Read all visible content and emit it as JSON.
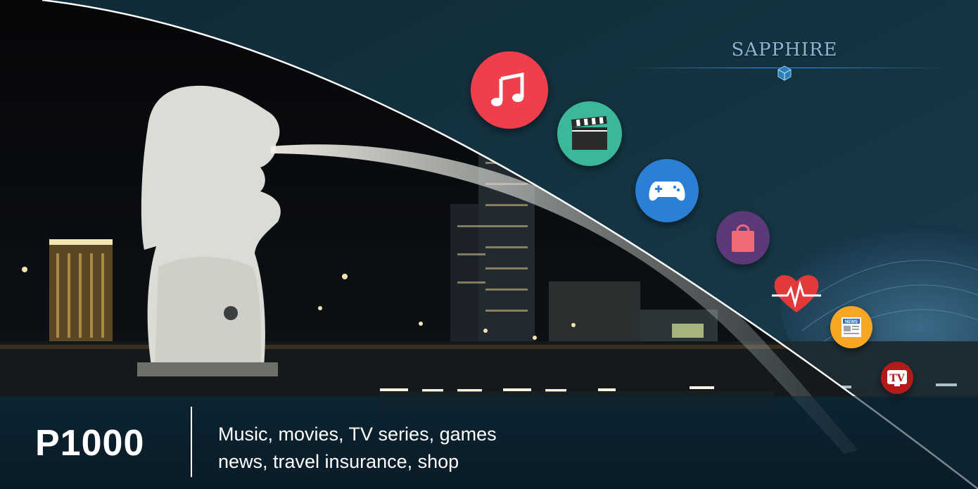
{
  "brand": {
    "name": "SAPPHIRE"
  },
  "offer": {
    "price": "P1000",
    "line1": "Music, movies, TV series, games",
    "line2": "news, travel insurance, shop"
  },
  "icons": [
    {
      "name": "music-icon",
      "color": "#ef3f4d"
    },
    {
      "name": "clapperboard-icon",
      "color": "#3bb89a"
    },
    {
      "name": "gamepad-icon",
      "color": "#2b7fd6"
    },
    {
      "name": "shopping-bag-icon",
      "color": "#5b3a77"
    },
    {
      "name": "heartbeat-icon",
      "color": "#e23a3a"
    },
    {
      "name": "news-icon",
      "color": "#f5a623",
      "label": "NEWS"
    },
    {
      "name": "tv-icon",
      "color": "#b31b1b",
      "label": "TV"
    }
  ],
  "colors": {
    "brand_blue": "#8fb4d6",
    "accent_line": "#3c8fd0",
    "text": "#ffffff"
  }
}
